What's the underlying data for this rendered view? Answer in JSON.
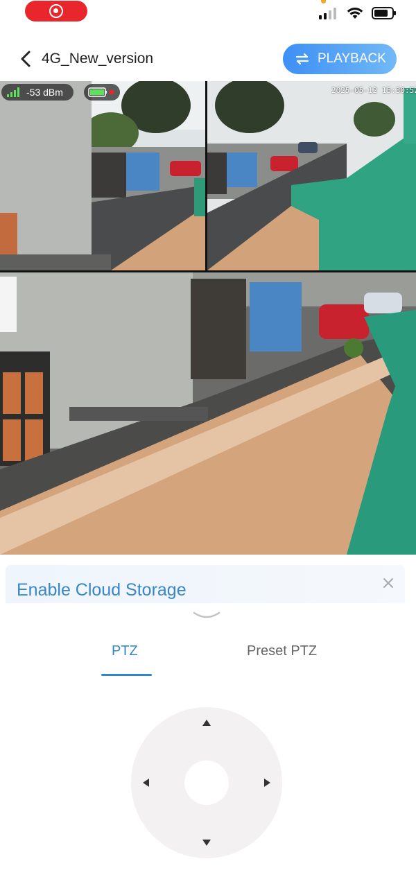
{
  "status_bar": {
    "record_color": "#e8262b",
    "icons": [
      "record-icon",
      "cellular-signal-icon",
      "wifi-icon",
      "battery-icon"
    ]
  },
  "nav": {
    "title": "4G_New_version",
    "back_icon": "chevron-left-icon",
    "playback_label": "PLAYBACK",
    "playback_icon": "swap-arrows-icon",
    "accent": "#3d8ff5"
  },
  "video": {
    "signal_text": "-53 dBm",
    "signal_icon": "signal-bars-icon",
    "battery_icon": "battery-charging-icon",
    "timestamp": "2025-05-12 15:30:52"
  },
  "cloud_banner": {
    "title": "Enable Cloud Storage",
    "close_icon": "close-icon",
    "title_color": "#3a86c8"
  },
  "tabs": [
    {
      "label": "PTZ",
      "active": true
    },
    {
      "label": "Preset PTZ",
      "active": false
    }
  ],
  "ptz": {
    "icons": [
      "arrow-up-icon",
      "arrow-down-icon",
      "arrow-left-icon",
      "arrow-right-icon"
    ]
  }
}
